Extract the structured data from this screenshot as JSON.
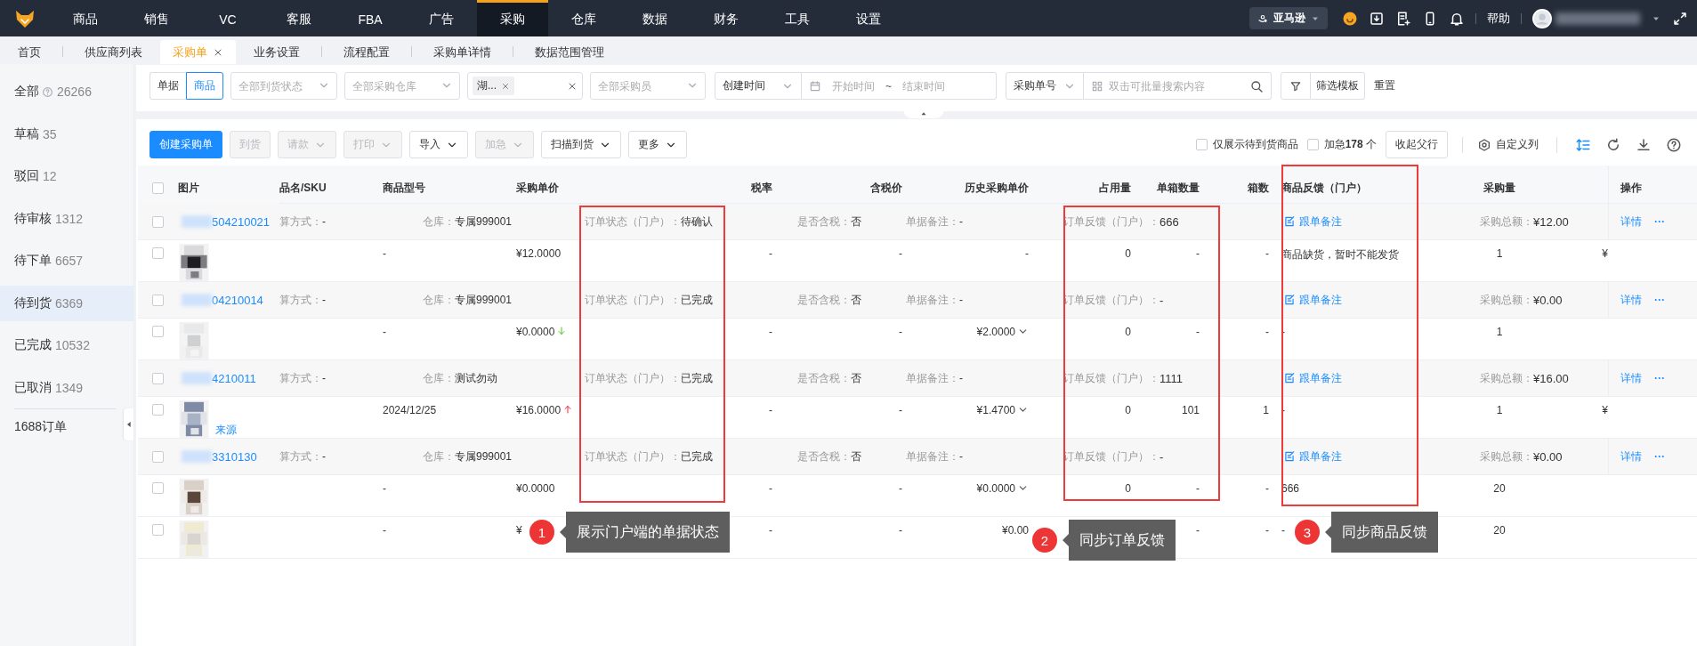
{
  "top_nav": {
    "items": [
      {
        "label": "商品",
        "selected": false
      },
      {
        "label": "销售",
        "selected": false
      },
      {
        "label": "VC",
        "selected": false
      },
      {
        "label": "客服",
        "selected": false
      },
      {
        "label": "FBA",
        "selected": false
      },
      {
        "label": "广告",
        "selected": false
      },
      {
        "label": "采购",
        "selected": true
      },
      {
        "label": "仓库",
        "selected": false
      },
      {
        "label": "数据",
        "selected": false
      },
      {
        "label": "财务",
        "selected": false
      },
      {
        "label": "工具",
        "selected": false
      },
      {
        "label": "设置",
        "selected": false
      }
    ],
    "store": "亚马逊",
    "help": "帮助"
  },
  "tabs": [
    {
      "label": "首页",
      "selected": false,
      "closable": false
    },
    {
      "label": "供应商列表",
      "selected": false,
      "closable": false
    },
    {
      "label": "采购单",
      "selected": true,
      "closable": true
    },
    {
      "label": "业务设置",
      "selected": false,
      "closable": false
    },
    {
      "label": "流程配置",
      "selected": false,
      "closable": false
    },
    {
      "label": "采购单详情",
      "selected": false,
      "closable": false
    },
    {
      "label": "数据范围管理",
      "selected": false,
      "closable": false
    }
  ],
  "sidebar": {
    "items": [
      {
        "label": "全部",
        "count": "26266",
        "help": true,
        "selected": false
      },
      {
        "label": "草稿",
        "count": "35",
        "help": false,
        "selected": false
      },
      {
        "label": "驳回",
        "count": "12",
        "help": false,
        "selected": false
      },
      {
        "label": "待审核",
        "count": "1312",
        "help": false,
        "selected": false
      },
      {
        "label": "待下单",
        "count": "6657",
        "help": false,
        "selected": false
      },
      {
        "label": "待到货",
        "count": "6369",
        "help": false,
        "selected": true
      },
      {
        "label": "已完成",
        "count": "10532",
        "help": false,
        "selected": false
      },
      {
        "label": "已取消",
        "count": "1349",
        "help": false,
        "selected": false
      }
    ],
    "link": "1688订单"
  },
  "filters": {
    "mode": [
      {
        "label": "单据",
        "selected": false
      },
      {
        "label": "商品",
        "selected": true
      }
    ],
    "selects": [
      {
        "placeholder": "全部到货状态"
      },
      {
        "placeholder": "全部采购仓库"
      }
    ],
    "tag_field": {
      "tags": [
        "湖..."
      ]
    },
    "buyer": {
      "placeholder": "全部采购员"
    },
    "date_type": "创建时间",
    "date_start": {
      "placeholder": "开始时间"
    },
    "date_separator": "~",
    "date_end": {
      "placeholder": "结束时间"
    },
    "search_type": "采购单号",
    "search": {
      "placeholder": "双击可批量搜索内容"
    },
    "template_button": "筛选模板",
    "reset": "重置"
  },
  "toolbar": {
    "buttons": [
      {
        "label": "创建采购单",
        "kind": "primary",
        "disabled": false,
        "dropdown": false
      },
      {
        "label": "到货",
        "kind": "default",
        "disabled": true,
        "dropdown": false
      },
      {
        "label": "请款",
        "kind": "default",
        "disabled": true,
        "dropdown": true
      },
      {
        "label": "打印",
        "kind": "default",
        "disabled": true,
        "dropdown": true
      },
      {
        "label": "导入",
        "kind": "default",
        "disabled": false,
        "dropdown": true
      },
      {
        "label": "加急",
        "kind": "default",
        "disabled": true,
        "dropdown": true
      },
      {
        "label": "扫描到货",
        "kind": "default",
        "disabled": false,
        "dropdown": true
      },
      {
        "label": "更多",
        "kind": "default",
        "disabled": false,
        "dropdown": true
      }
    ],
    "checks": [
      {
        "label": "仅展示待到货商品",
        "checked": false
      },
      {
        "label": "加急**178** 个",
        "checked": false
      }
    ],
    "collapse_button": "收起父行",
    "column_settings": "自定义列"
  },
  "table": {
    "select_all": {
      "checked": false
    },
    "columns": [
      "图片",
      "品名/SKU",
      "商品型号",
      "采购单价",
      "税率",
      "含税价",
      "历史采购单价",
      "占用量",
      "单箱数量",
      "箱数",
      "商品反馈（门户）",
      "采购量",
      "操作"
    ],
    "orders": [
      {
        "checked": false,
        "order_no": "504210021",
        "settlement": {
          "label": "算方式：",
          "value": "-"
        },
        "warehouse": {
          "label": "仓库：",
          "value": "专属999001"
        },
        "portal_status": {
          "label": "订单状态（门户）：",
          "value": "待确认"
        },
        "tax_included": {
          "label": "是否含税：",
          "value": "否"
        },
        "remark": {
          "label": "单据备注：",
          "value": "-"
        },
        "portal_feedback": {
          "label": "订单反馈（门户）：",
          "value": "666"
        },
        "follow_note": "跟单备注",
        "total": {
          "label": "采购总额：",
          "value": "¥12.00"
        },
        "actions": [
          "详情",
          "···"
        ],
        "items": [
          {
            "checked": false,
            "model": "-",
            "price": "¥12.0000",
            "tax_rate": "-",
            "tax_price": "-",
            "history": "-",
            "history_menu": false,
            "occupied": "0",
            "per_box": "-",
            "boxes": "-",
            "feedback": "商品缺货，暂时不能发货",
            "quantity": "1",
            "column_13": "¥"
          }
        ]
      },
      {
        "checked": false,
        "order_no": "04210014",
        "settlement": {
          "label": "算方式：",
          "value": "-"
        },
        "warehouse": {
          "label": "仓库：",
          "value": "专属999001"
        },
        "portal_status": {
          "label": "订单状态（门户）：",
          "value": "已完成"
        },
        "tax_included": {
          "label": "是否含税：",
          "value": "否"
        },
        "remark": {
          "label": "单据备注：",
          "value": "-"
        },
        "portal_feedback": {
          "label": "订单反馈（门户）：",
          "value": "-"
        },
        "follow_note": "跟单备注",
        "total": {
          "label": "采购总额：",
          "value": "¥0.00"
        },
        "actions": [
          "详情",
          "···"
        ],
        "items": [
          {
            "checked": false,
            "model": "-",
            "price": "¥0.0000",
            "price_rising": false,
            "tax_rate": "-",
            "tax_price": "-",
            "history": "¥2.0000",
            "history_menu": true,
            "occupied": "0",
            "per_box": "-",
            "boxes": "-",
            "feedback": "-",
            "quantity": "1"
          }
        ]
      },
      {
        "checked": false,
        "order_no": "4210011",
        "settlement": {
          "label": "算方式：",
          "value": "-"
        },
        "warehouse": {
          "label": "仓库：",
          "value": "测试勿动"
        },
        "portal_status": {
          "label": "订单状态（门户）：",
          "value": "已完成"
        },
        "tax_included": {
          "label": "是否含税：",
          "value": "否"
        },
        "remark": {
          "label": "单据备注：",
          "value": "-"
        },
        "portal_feedback": {
          "label": "订单反馈（门户）：",
          "value": "1111"
        },
        "follow_note": "跟单备注",
        "total": {
          "label": "采购总额：",
          "value": "¥16.00"
        },
        "actions": [
          "详情",
          "···"
        ],
        "items": [
          {
            "checked": false,
            "source": "来源",
            "model": "2024/12/25",
            "price": "¥16.0000",
            "price_rising": true,
            "tax_rate": "-",
            "tax_price": "-",
            "history": "¥1.4700",
            "history_menu": true,
            "occupied": "0",
            "per_box": "101",
            "boxes": "1",
            "feedback": "-",
            "quantity": "1",
            "column_13": "¥"
          }
        ]
      },
      {
        "checked": false,
        "order_no": "3310130",
        "settlement": {
          "label": "算方式：",
          "value": "-"
        },
        "warehouse": {
          "label": "仓库：",
          "value": "专属999001"
        },
        "portal_status": {
          "label": "订单状态（门户）：",
          "value": "已完成"
        },
        "tax_included": {
          "label": "是否含税：",
          "value": "否"
        },
        "remark": {
          "label": "单据备注：",
          "value": "-"
        },
        "portal_feedback": {
          "label": "订单反馈（门户）：",
          "value": "-"
        },
        "follow_note": "跟单备注",
        "total": {
          "label": "采购总额：",
          "value": "¥0.00"
        },
        "actions": [
          "详情",
          "···"
        ],
        "items": [
          {
            "checked": false,
            "model": "-",
            "price": "¥0.0000",
            "tax_rate": "-",
            "tax_price": "-",
            "history": "¥0.0000",
            "history_menu": true,
            "occupied": "0",
            "per_box": "-",
            "boxes": "-",
            "feedback": "666",
            "quantity": "20"
          },
          {
            "checked": false,
            "model": "-",
            "price": "¥",
            "tax_rate": "-",
            "tax_price": "-",
            "history": "¥0.00",
            "history_menu": false,
            "per_box": "-",
            "boxes": "-",
            "feedback": "-",
            "quantity": "20"
          }
        ]
      }
    ]
  },
  "annotations": [
    {
      "number": "1",
      "text": "展示门户端的单据状态"
    },
    {
      "number": "2",
      "text": "同步订单反馈"
    },
    {
      "number": "3",
      "text": "同步商品反馈"
    }
  ]
}
